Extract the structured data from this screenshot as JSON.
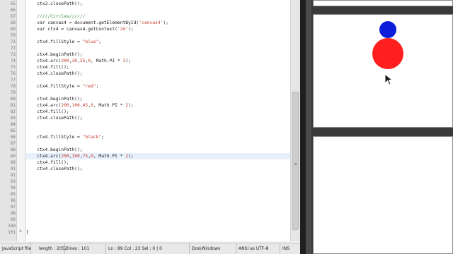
{
  "editor": {
    "lines": [
      {
        "num": "65",
        "code": "    ctx3.closePath();"
      },
      {
        "num": "66",
        "code": ""
      },
      {
        "num": "67",
        "code": "    /////Circles//////",
        "kind": "comment"
      },
      {
        "num": "68",
        "code": "    var canvas4 = document.getElementById('canvas4');"
      },
      {
        "num": "69",
        "code": "    var ctx4 = canvas4.getContext('2d');"
      },
      {
        "num": "70",
        "code": ""
      },
      {
        "num": "71",
        "code": "    ctx4.fillStyle = \"blue\";"
      },
      {
        "num": "72",
        "code": ""
      },
      {
        "num": "73",
        "code": "    ctx4.beginPath();"
      },
      {
        "num": "74",
        "code": "    ctx4.arc(200,30,25,0, Math.PI * 2);"
      },
      {
        "num": "75",
        "code": "    ctx4.fill();"
      },
      {
        "num": "76",
        "code": "    ctx4.closePath();"
      },
      {
        "num": "77",
        "code": ""
      },
      {
        "num": "78",
        "code": "    ctx4.fillStyle = \"red\";"
      },
      {
        "num": "79",
        "code": ""
      },
      {
        "num": "80",
        "code": "    ctx4.beginPath();"
      },
      {
        "num": "81",
        "code": "    ctx4.arc(200,100,45,0, Math.PI * 2);"
      },
      {
        "num": "82",
        "code": "    ctx4.fill();"
      },
      {
        "num": "83",
        "code": "    ctx4.closePath();"
      },
      {
        "num": "84",
        "code": ""
      },
      {
        "num": "85",
        "code": ""
      },
      {
        "num": "86",
        "code": "    ctx4.fillStyle = \"black\";"
      },
      {
        "num": "87",
        "code": ""
      },
      {
        "num": "88",
        "code": "    ctx4.beginPath();"
      },
      {
        "num": "89",
        "code": "    ctx4.arc(200,100,75,0, Math.PI * 2);",
        "current": true
      },
      {
        "num": "90",
        "code": "    ctx4.fill();"
      },
      {
        "num": "91",
        "code": "    ctx4.closePath();"
      },
      {
        "num": "92",
        "code": ""
      },
      {
        "num": "93",
        "code": ""
      },
      {
        "num": "94",
        "code": ""
      },
      {
        "num": "95",
        "code": ""
      },
      {
        "num": "96",
        "code": ""
      },
      {
        "num": "97",
        "code": ""
      },
      {
        "num": "98",
        "code": ""
      },
      {
        "num": "99",
        "code": ""
      },
      {
        "num": "100",
        "code": ""
      },
      {
        "num": "101",
        "code": "}"
      }
    ]
  },
  "status": {
    "file_type": "JavaScript file",
    "length": "length : 2052",
    "lines": "lines : 101",
    "position": "Ln : 89   Col : 23   Sel : 0 | 0",
    "eol": "Dos\\Windows",
    "encoding": "ANSI as UTF-8",
    "mode": "INS"
  },
  "colors": {
    "circle_blue": "#0b1fdb",
    "circle_red": "#ff1f1f"
  },
  "icons": {
    "cursor": "mouse-pointer-icon"
  }
}
